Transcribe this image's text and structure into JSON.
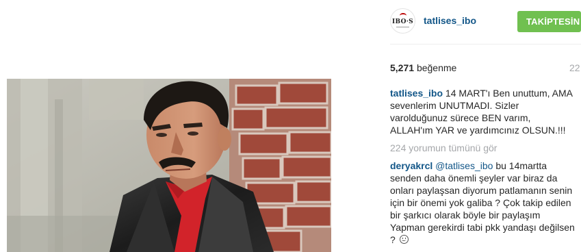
{
  "post": {
    "username": "tatlises_ibo",
    "avatar_text": "IBO·S",
    "follow_label": "TAKİPTESİN",
    "likes_count": "5,271",
    "likes_unit": "beğenme",
    "time_ago": "22",
    "caption": {
      "user": "tatlises_ibo",
      "text": "14 MART'ı Ben unuttum, AMA sevenlerim UNUTMADI. Sizler varolduğunuz sürece BEN varım, ALLAH'ım YAR ve yardımcınız OLSUN.!!!"
    },
    "view_all_comments": "224 yorumun tümünü gör",
    "comments": [
      {
        "user": "deryakrcl",
        "mention": "@tatlises_ibo",
        "text": "bu 14martta senden daha önemli şeyler var biraz da onları paylaşsan diyorum patlamanın senin için bir önemi yok galiba ? Çok takip edilen bir şarkıcı olarak böyle bir paylaşım Yapman gerekirdi tabi pkk yandaşı değilsen ?"
      }
    ]
  },
  "colors": {
    "link": "#125688",
    "follow_bg": "#70c050",
    "muted": "#a5a7aa",
    "text": "#262626"
  }
}
